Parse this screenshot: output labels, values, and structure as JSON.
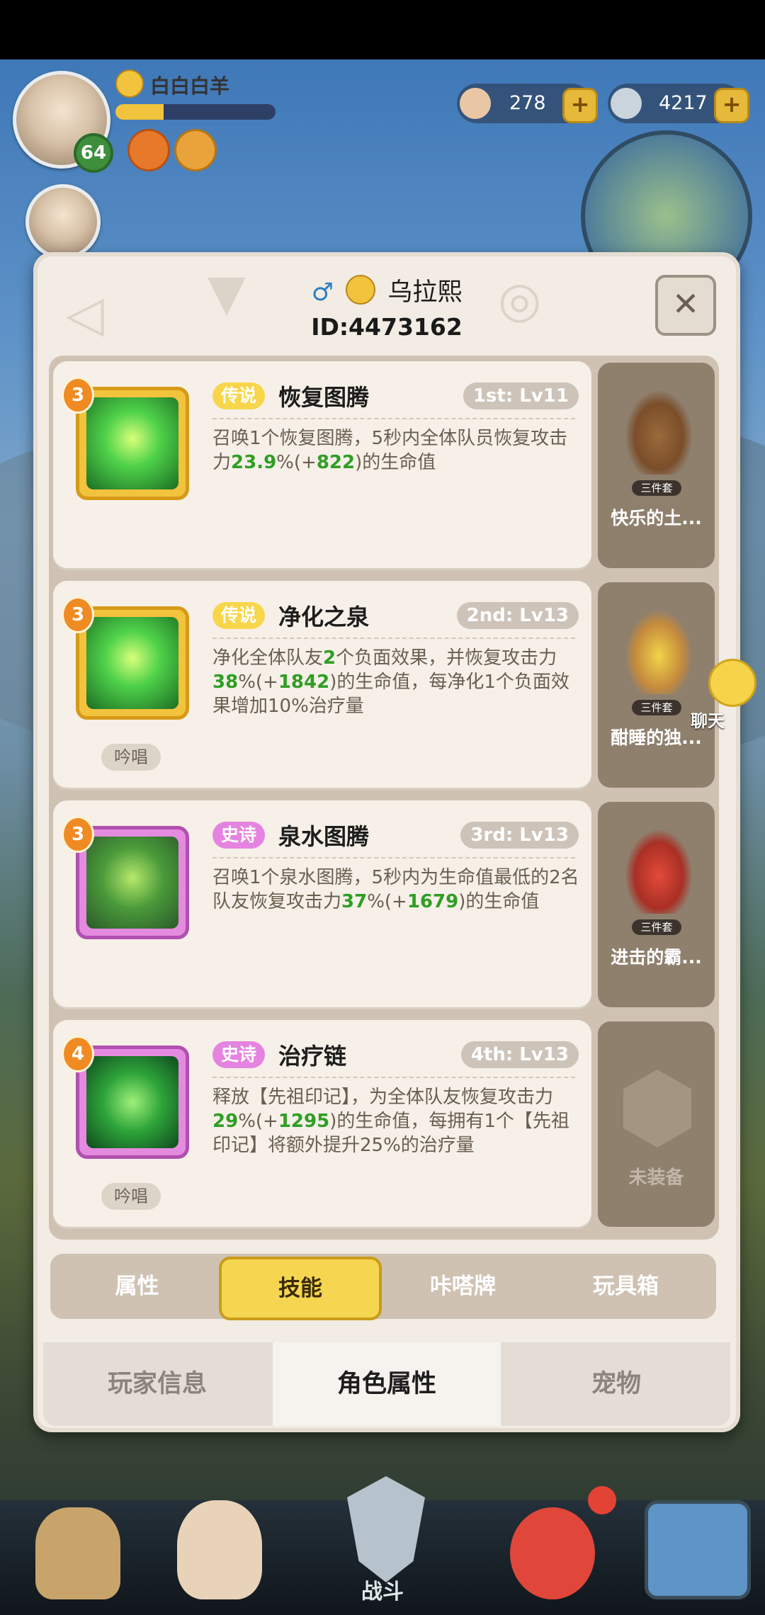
{
  "hud": {
    "player_name": "白白白羊",
    "level": "64",
    "shells": "278",
    "pearls": "4217"
  },
  "panel": {
    "player_name": "乌拉熙",
    "player_id": "ID:4473162",
    "gender_symbol": "♂",
    "close_symbol": "✕"
  },
  "skills": [
    {
      "badge": "3",
      "rarity": "传说",
      "name": "恢复图腾",
      "slot": "1st: Lv11",
      "desc_parts": [
        "召唤1个恢复图腾，5秒内全体队员恢复攻击力",
        "23.9",
        "%(+",
        "822",
        ")的生命值"
      ],
      "chant": "",
      "set_name": "快乐的土...",
      "set_tag": "三件套"
    },
    {
      "badge": "3",
      "rarity": "传说",
      "name": "净化之泉",
      "slot": "2nd: Lv13",
      "desc_parts": [
        "净化全体队友",
        "2",
        "个负面效果，并恢复攻击力",
        "38",
        "%(+",
        "1842",
        ")的生命值，每净化1个负面效果增加10%治疗量"
      ],
      "chant": "吟唱",
      "set_name": "酣睡的独...",
      "set_tag": "三件套"
    },
    {
      "badge": "3",
      "rarity": "史诗",
      "name": "泉水图腾",
      "slot": "3rd: Lv13",
      "desc_parts": [
        "召唤1个泉水图腾，5秒内为生命值最低的2名队友恢复攻击力",
        "37",
        "%(+",
        "1679",
        ")的生命值"
      ],
      "chant": "",
      "set_name": "进击的霸...",
      "set_tag": "三件套"
    },
    {
      "badge": "4",
      "rarity": "史诗",
      "name": "治疗链",
      "slot": "4th: Lv13",
      "desc_parts": [
        "释放【先祖印记】，为全体队友恢复攻击力",
        "29",
        "%(+",
        "1295",
        ")的生命值，每拥有1个【先祖印记】将额外提升25%的治疗量"
      ],
      "chant": "吟唱",
      "set_name": "未装备",
      "set_tag": ""
    }
  ],
  "sub_tabs": [
    "属性",
    "技能",
    "咔嗒牌",
    "玩具箱"
  ],
  "main_tabs": [
    "玩家信息",
    "角色属性",
    "宠物"
  ],
  "chat_label": "聊天",
  "battle_label": "战斗"
}
